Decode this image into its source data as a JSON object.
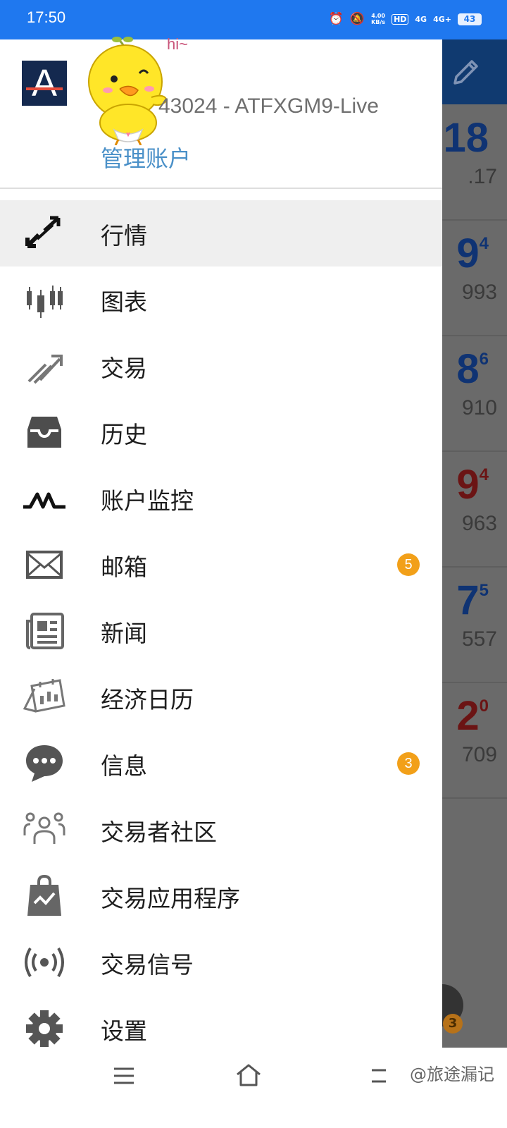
{
  "status_bar": {
    "time": "17:50",
    "net_speed_value": "4.00",
    "net_speed_unit": "KB/s",
    "hd_label": "HD",
    "net1": "4G",
    "net2": "4G+",
    "battery": "43"
  },
  "drawer": {
    "sticker_text": "hi~",
    "account_text": "43024 - ATFXGM9-Live",
    "manage_label": "管理账户",
    "items": [
      {
        "label": "行情",
        "icon": "quotes-arrows-icon",
        "badge": null,
        "active": true
      },
      {
        "label": "图表",
        "icon": "candlestick-chart-icon",
        "badge": null
      },
      {
        "label": "交易",
        "icon": "trade-trend-icon",
        "badge": null
      },
      {
        "label": "历史",
        "icon": "history-inbox-icon",
        "badge": null
      },
      {
        "label": "账户监控",
        "icon": "account-monitor-icon",
        "badge": null
      },
      {
        "label": "邮箱",
        "icon": "mail-icon",
        "badge": "5"
      },
      {
        "label": "新闻",
        "icon": "news-icon",
        "badge": null
      },
      {
        "label": "经济日历",
        "icon": "economic-calendar-icon",
        "badge": null
      },
      {
        "label": "信息",
        "icon": "chat-bubble-icon",
        "badge": "3"
      },
      {
        "label": "交易者社区",
        "icon": "community-icon",
        "badge": null
      },
      {
        "label": "交易应用程序",
        "icon": "app-store-bag-icon",
        "badge": null
      },
      {
        "label": "交易信号",
        "icon": "signal-broadcast-icon",
        "badge": null
      },
      {
        "label": "设置",
        "icon": "settings-gear-icon",
        "badge": null
      }
    ]
  },
  "background": {
    "rows": [
      {
        "big": "18",
        "sup": "",
        "small": ".17",
        "color": "blue"
      },
      {
        "big": "9",
        "sup": "4",
        "small": "993",
        "color": "blue"
      },
      {
        "big": "8",
        "sup": "6",
        "small": "910",
        "color": "blue"
      },
      {
        "big": "9",
        "sup": "4",
        "small": "963",
        "color": "red"
      },
      {
        "big": "7",
        "sup": "5",
        "small": "557",
        "color": "blue"
      },
      {
        "big": "2",
        "sup": "0",
        "small": "709",
        "color": "red"
      }
    ],
    "fab_badge": "3"
  },
  "navbar": {
    "watermark": "@旅途漏记"
  }
}
